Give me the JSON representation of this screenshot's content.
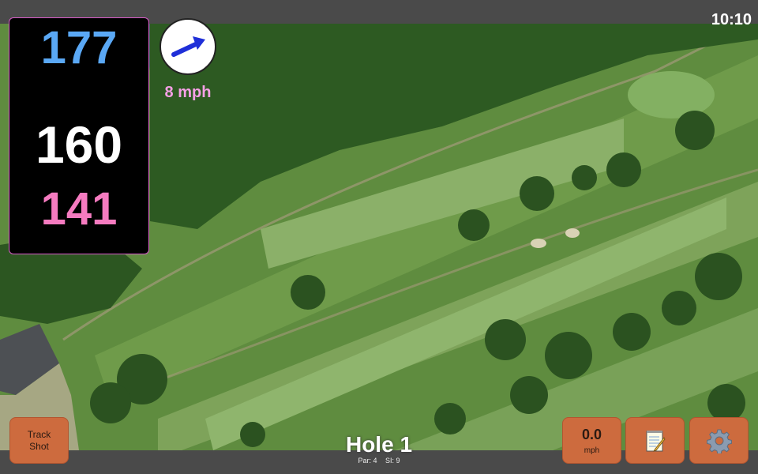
{
  "status_bar": {
    "time": "10:10"
  },
  "yardage": {
    "back": "177",
    "middle": "160",
    "front": "141"
  },
  "wind": {
    "speed_label": "8 mph",
    "arrow_icon": "wind-direction-arrow-icon"
  },
  "buttons": {
    "track_shot": {
      "line1": "Track",
      "line2": "Shot"
    },
    "wind_speed": {
      "value": "0.0",
      "unit": "mph"
    },
    "notes": {
      "icon": "notepad-pencil-icon"
    },
    "settings": {
      "icon": "gear-icon"
    }
  },
  "hole": {
    "title": "Hole 1",
    "par": "Par: 4",
    "si": "SI: 9"
  },
  "colors": {
    "back_yardage": "#5aa8f5",
    "middle_yardage": "#ffffff",
    "front_yardage": "#f57bc0",
    "button_orange": "#cd6b3e"
  }
}
